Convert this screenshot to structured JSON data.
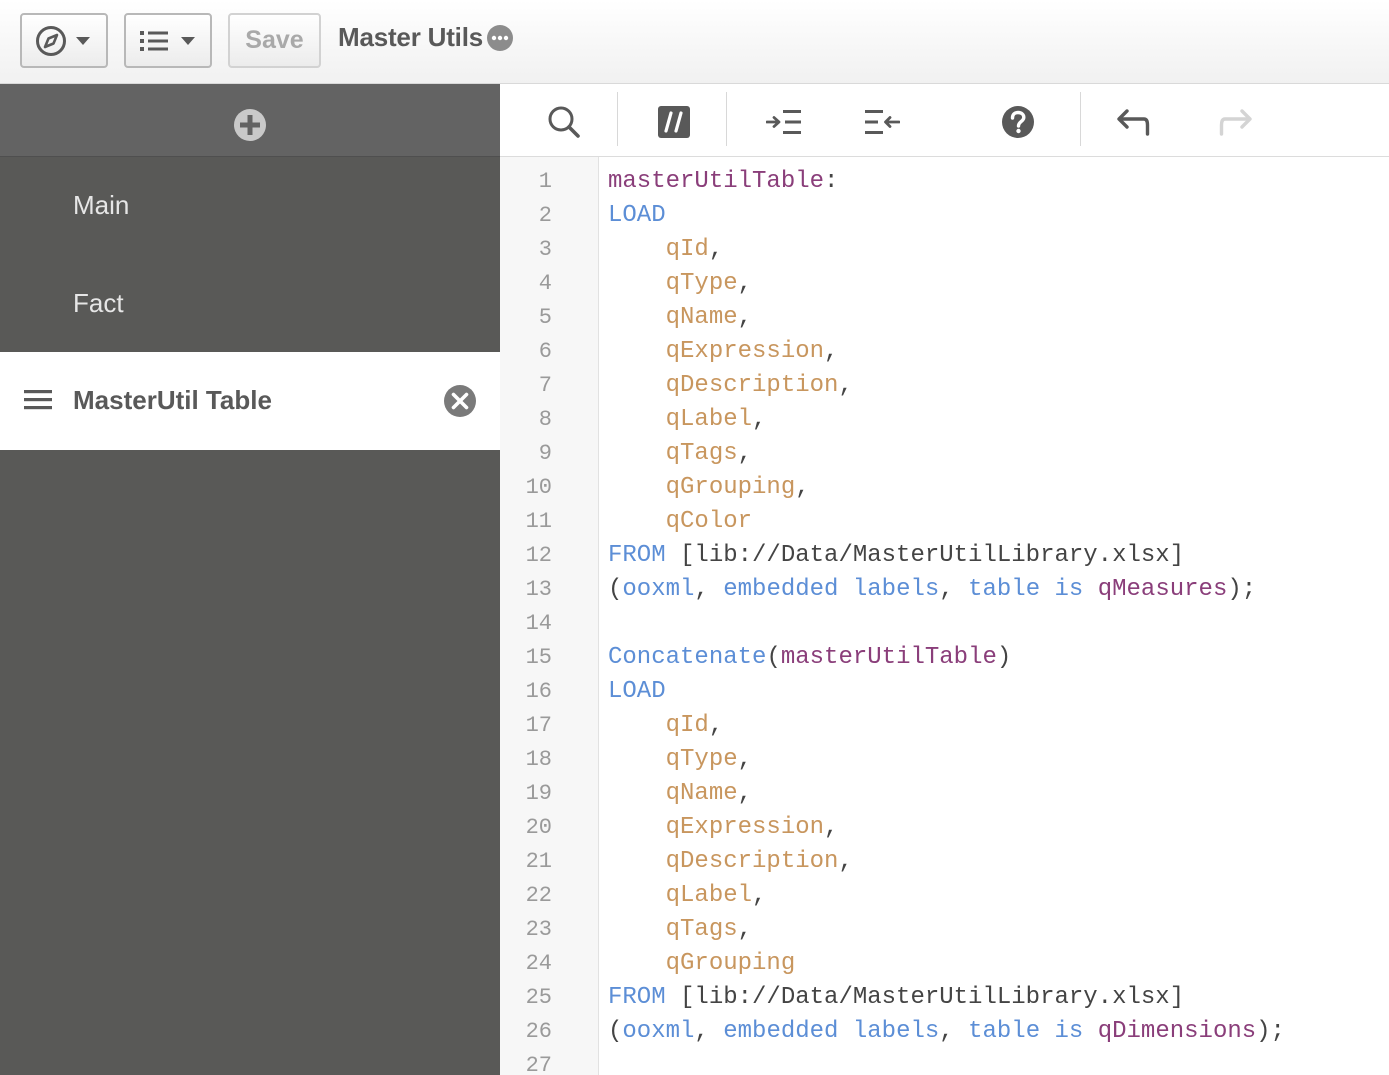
{
  "topbar": {
    "nav_icon": "compass-icon",
    "sheet_icon": "list-icon",
    "save_label": "Save",
    "app_title": "Master Utils",
    "more_icon": "more-icon"
  },
  "sidebar": {
    "add_icon": "plus-circle-icon",
    "sections": [
      {
        "label": "Main",
        "active": false
      },
      {
        "label": "Fact",
        "active": false
      },
      {
        "label": "MasterUtil Table",
        "active": true
      }
    ]
  },
  "editor_toolbar": {
    "icons": [
      "search-icon",
      "comment-icon",
      "indent-icon",
      "outdent-icon",
      "help-icon",
      "undo-icon",
      "redo-icon"
    ],
    "redo_disabled": true
  },
  "editor": {
    "line_numbers": [
      "1",
      "2",
      "3",
      "4",
      "5",
      "6",
      "7",
      "8",
      "9",
      "10",
      "11",
      "12",
      "13",
      "14",
      "15",
      "16",
      "17",
      "18",
      "19",
      "20",
      "21",
      "22",
      "23",
      "24",
      "25",
      "26",
      "27"
    ],
    "lines": [
      [
        [
          "masterUtilTable",
          "tbl"
        ],
        [
          ":",
          "pn"
        ]
      ],
      [
        [
          "LOAD",
          "kw"
        ]
      ],
      [
        [
          "    ",
          "txt"
        ],
        [
          "qId",
          "fld"
        ],
        [
          ",",
          "pn"
        ]
      ],
      [
        [
          "    ",
          "txt"
        ],
        [
          "qType",
          "fld"
        ],
        [
          ",",
          "pn"
        ]
      ],
      [
        [
          "    ",
          "txt"
        ],
        [
          "qName",
          "fld"
        ],
        [
          ",",
          "pn"
        ]
      ],
      [
        [
          "    ",
          "txt"
        ],
        [
          "qExpression",
          "fld"
        ],
        [
          ",",
          "pn"
        ]
      ],
      [
        [
          "    ",
          "txt"
        ],
        [
          "qDescription",
          "fld"
        ],
        [
          ",",
          "pn"
        ]
      ],
      [
        [
          "    ",
          "txt"
        ],
        [
          "qLabel",
          "fld"
        ],
        [
          ",",
          "pn"
        ]
      ],
      [
        [
          "    ",
          "txt"
        ],
        [
          "qTags",
          "fld"
        ],
        [
          ",",
          "pn"
        ]
      ],
      [
        [
          "    ",
          "txt"
        ],
        [
          "qGrouping",
          "fld"
        ],
        [
          ",",
          "pn"
        ]
      ],
      [
        [
          "    ",
          "txt"
        ],
        [
          "qColor",
          "fld"
        ]
      ],
      [
        [
          "FROM",
          "kw"
        ],
        [
          " [lib://Data/MasterUtilLibrary.xlsx]",
          "txt"
        ]
      ],
      [
        [
          "(",
          "pn"
        ],
        [
          "ooxml",
          "kw"
        ],
        [
          ", ",
          "pn"
        ],
        [
          "embedded labels",
          "kw"
        ],
        [
          ", ",
          "pn"
        ],
        [
          "table is",
          "kw"
        ],
        [
          " ",
          "pn"
        ],
        [
          "qMeasures",
          "tbl"
        ],
        [
          ");",
          "pn"
        ]
      ],
      [],
      [
        [
          "Concatenate",
          "kw"
        ],
        [
          "(",
          "pn"
        ],
        [
          "masterUtilTable",
          "tbl"
        ],
        [
          ")",
          "pn"
        ]
      ],
      [
        [
          "LOAD",
          "kw"
        ]
      ],
      [
        [
          "    ",
          "txt"
        ],
        [
          "qId",
          "fld"
        ],
        [
          ",",
          "pn"
        ]
      ],
      [
        [
          "    ",
          "txt"
        ],
        [
          "qType",
          "fld"
        ],
        [
          ",",
          "pn"
        ]
      ],
      [
        [
          "    ",
          "txt"
        ],
        [
          "qName",
          "fld"
        ],
        [
          ",",
          "pn"
        ]
      ],
      [
        [
          "    ",
          "txt"
        ],
        [
          "qExpression",
          "fld"
        ],
        [
          ",",
          "pn"
        ]
      ],
      [
        [
          "    ",
          "txt"
        ],
        [
          "qDescription",
          "fld"
        ],
        [
          ",",
          "pn"
        ]
      ],
      [
        [
          "    ",
          "txt"
        ],
        [
          "qLabel",
          "fld"
        ],
        [
          ",",
          "pn"
        ]
      ],
      [
        [
          "    ",
          "txt"
        ],
        [
          "qTags",
          "fld"
        ],
        [
          ",",
          "pn"
        ]
      ],
      [
        [
          "    ",
          "txt"
        ],
        [
          "qGrouping",
          "fld"
        ]
      ],
      [
        [
          "FROM",
          "kw"
        ],
        [
          " [lib://Data/MasterUtilLibrary.xlsx]",
          "txt"
        ]
      ],
      [
        [
          "(",
          "pn"
        ],
        [
          "ooxml",
          "kw"
        ],
        [
          ", ",
          "pn"
        ],
        [
          "embedded labels",
          "kw"
        ],
        [
          ", ",
          "pn"
        ],
        [
          "table is",
          "kw"
        ],
        [
          " ",
          "pn"
        ],
        [
          "qDimensions",
          "tbl"
        ],
        [
          ");",
          "pn"
        ]
      ],
      []
    ]
  }
}
